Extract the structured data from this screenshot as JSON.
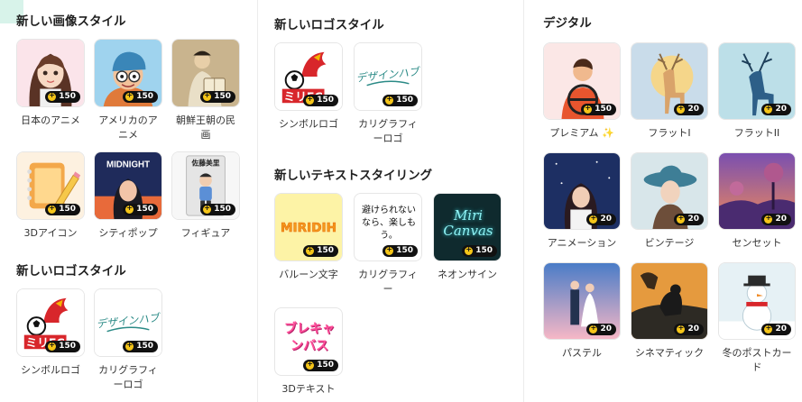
{
  "col1": {
    "section1": {
      "title": "新しい画像スタイル",
      "items": [
        {
          "label": "日本のアニメ",
          "price": "150"
        },
        {
          "label": "アメリカのアニメ",
          "price": "150"
        },
        {
          "label": "朝鮮王朝の民画",
          "price": "150"
        },
        {
          "label": "3Dアイコン",
          "price": "150"
        },
        {
          "label": "シティポップ",
          "price": "150",
          "thumb_text": "MIDNIGHT"
        },
        {
          "label": "フィギュア",
          "price": "150",
          "thumb_text": "佐藤美里"
        }
      ]
    },
    "section2": {
      "title": "新しいロゴスタイル",
      "items": [
        {
          "label": "シンボルロゴ",
          "price": "150",
          "thumb_text": "ミリFC"
        },
        {
          "label": "カリグラフィーロゴ",
          "price": "150",
          "thumb_text": "デザインハブ"
        }
      ]
    }
  },
  "col2": {
    "section1": {
      "title": "新しいロゴスタイル",
      "items": [
        {
          "label": "シンボルロゴ",
          "price": "150",
          "thumb_text": "ミリFC"
        },
        {
          "label": "カリグラフィーロゴ",
          "price": "150",
          "thumb_text": "デザインハブ"
        }
      ]
    },
    "section2": {
      "title": "新しいテキストスタイリング",
      "items": [
        {
          "label": "バルーン文字",
          "price": "150",
          "thumb_text": "MIRIDIH"
        },
        {
          "label": "カリグラフィー",
          "price": "150",
          "thumb_text": "避けられないなら、楽しもう。"
        },
        {
          "label": "ネオンサイン",
          "price": "150",
          "thumb_text": "Miri Canvas"
        },
        {
          "label": "3Dテキスト",
          "price": "150",
          "thumb_text": "ブレキャンバス"
        }
      ]
    }
  },
  "col3": {
    "title": "デジタル",
    "items": [
      {
        "label": "プレミアム ✨",
        "price": "150"
      },
      {
        "label": "フラットI",
        "price": "20"
      },
      {
        "label": "フラットII",
        "price": "20"
      },
      {
        "label": "アニメーション",
        "price": "20"
      },
      {
        "label": "ビンテージ",
        "price": "20"
      },
      {
        "label": "センセット",
        "price": "20"
      },
      {
        "label": "パステル",
        "price": "20"
      },
      {
        "label": "シネマティック",
        "price": "20"
      },
      {
        "label": "冬のポストカード",
        "price": "20"
      }
    ]
  },
  "colors": {
    "badge_bg": "#111111",
    "coin": "#f5c518",
    "corner_mark": "#d8f3ea"
  }
}
